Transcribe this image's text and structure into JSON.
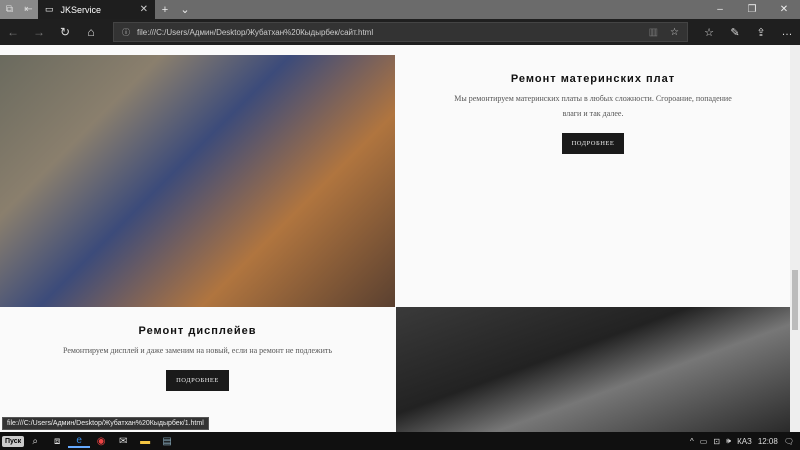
{
  "browser": {
    "tab_title": "JKService",
    "url": "file:///C:/Users/Админ/Desktop/Жубатхан%20Кыдырбек/сайт.html",
    "status_url": "file:///C:/Users/Админ/Desktop/Жубатхан%20Кыдырбек/1.html"
  },
  "services": [
    {
      "title": "Ремонт материнских плат",
      "description": "Мы ремонтируем материнских платы в любых сложности. Сгорoание, попадение влаги и так далее.",
      "button": "ПОДРОБНЕЕ"
    },
    {
      "title": "Ремонт дисплейев",
      "description": "Ремонтируем дисплей и даже заменим на новый, если на ремонт не подлежить",
      "button": "ПОДРОБНЕЕ"
    }
  ],
  "taskbar": {
    "start": "Пуск",
    "lang": "КАЗ",
    "time": "12:08"
  }
}
